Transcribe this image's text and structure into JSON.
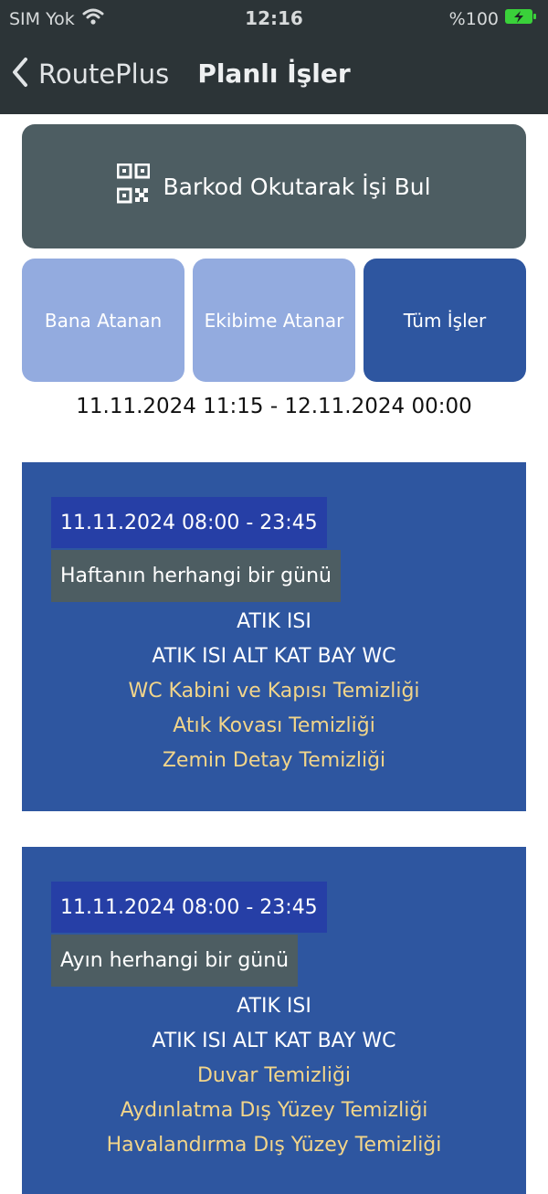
{
  "statusbar": {
    "carrier": "SIM Yok",
    "time": "12:16",
    "battery": "%100"
  },
  "navbar": {
    "back_label": "RoutePlus",
    "title": "Planlı İşler"
  },
  "barcode_button": {
    "label": "Barkod Okutarak İşi Bul",
    "icon": "qr-code-icon"
  },
  "tabs": [
    {
      "label": "Bana Atanan",
      "selected": false
    },
    {
      "label": "Ekibime Atanar",
      "selected": false
    },
    {
      "label": "Tüm İşler",
      "selected": true
    }
  ],
  "date_range": "11.11.2024 11:15 - 12.11.2024 00:00",
  "jobs": [
    {
      "date": "11.11.2024 08:00 - 23:45",
      "frequency": "Haftanın herhangi bir günü",
      "category": "ATIK ISI",
      "location": "ATIK ISI ALT KAT BAY WC",
      "tasks": [
        "WC Kabini ve Kapısı Temizliği",
        "Atık Kovası Temizliği",
        "Zemin Detay Temizliği"
      ]
    },
    {
      "date": "11.11.2024 08:00 - 23:45",
      "frequency": "Ayın herhangi bir günü",
      "category": "ATIK ISI",
      "location": "ATIK ISI ALT KAT BAY WC",
      "tasks": [
        "Duvar Temizliği",
        "Aydınlatma Dış Yüzey Temizliği",
        "Havalandırma Dış Yüzey Temizliği"
      ]
    }
  ],
  "colors": {
    "header": "#2c3437",
    "barcode_bg": "#4d5d62",
    "tab_light": "#93abdf",
    "tab_dark": "#2e56a0",
    "card": "#2e56a0",
    "date_chip": "#263fa6",
    "task_text": "#f2d58a",
    "battery_green": "#3ad13a"
  }
}
